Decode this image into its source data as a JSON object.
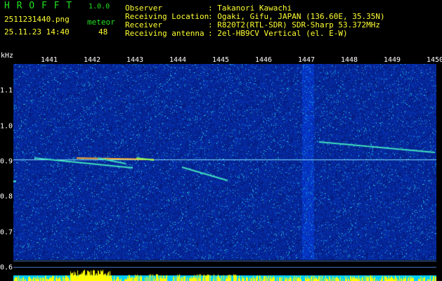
{
  "app": {
    "title": "H R O F F T",
    "version": "1.0.0",
    "filename": "2511231440.png",
    "datetime": "25.11.23 14:40",
    "mode_label": "meteor",
    "count": "48"
  },
  "info": {
    "observer_label": "Observer",
    "observer_value": ": Takanori Kawachi",
    "location_label": "Receiving Location",
    "location_value": ": Ogaki, Gifu, JAPAN (136.60E, 35.35N)",
    "receiver_label": "Receiver",
    "receiver_value": ": R820T2(RTL-SDR) SDR-Sharp 53.372MHz",
    "antenna_label": "Receiving antenna",
    "antenna_value": ": 2el-HB9CV Vertical (el. E-W)"
  },
  "axis": {
    "y_unit": "kHz",
    "x_ticks": [
      "1441",
      "1442",
      "1443",
      "1444",
      "1445",
      "1446",
      "1447",
      "1448",
      "1449",
      "1450"
    ],
    "y_ticks": [
      "1.1",
      "1.0",
      "0.9",
      "0.8",
      "0.7",
      "0.6"
    ]
  },
  "colors": {
    "background": "#000000",
    "spectrogram": "#0a1e8c",
    "header_green": "#22e022",
    "header_yellow": "#ffff33",
    "trace": "#40e0c0",
    "bottom_band": "#00d0ff",
    "bottom_peaks": "#ffff00"
  }
}
